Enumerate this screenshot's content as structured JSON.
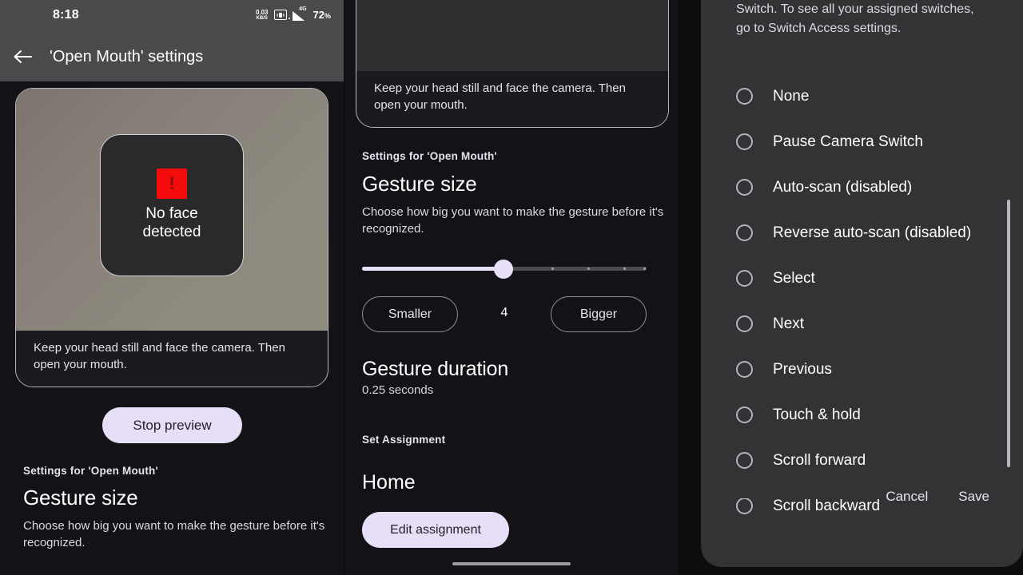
{
  "left_panel": {
    "status_bar": {
      "time": "8:18",
      "data_rate_value": "0.03",
      "data_rate_unit": "KB/S",
      "vibrate_icon": "vibrate-icon",
      "signal_label": "4G",
      "battery": "72",
      "battery_unit": "%"
    },
    "app_bar": {
      "back_icon": "back-arrow-icon",
      "title": "'Open Mouth' settings"
    },
    "preview": {
      "status_icon": "warning-icon",
      "status_glyph": "!",
      "status_text": "No face\ndetected",
      "caption": "Keep your head still and face the camera. Then open your mouth."
    },
    "stop_preview_label": "Stop preview",
    "section": {
      "overline": "Settings for 'Open Mouth'",
      "title": "Gesture size",
      "description": "Choose how big you want to make the gesture before it's recognized."
    }
  },
  "middle_panel": {
    "preview_caption": "Keep your head still and face the camera. Then open your mouth.",
    "section": {
      "overline": "Settings for 'Open Mouth'",
      "title": "Gesture size",
      "description": "Choose how big you want to make the gesture before it's recognized."
    },
    "slider": {
      "value": "4",
      "min": 0,
      "max": 8,
      "fill_percent": 50,
      "smaller_label": "Smaller",
      "bigger_label": "Bigger"
    },
    "gesture_duration": {
      "title": "Gesture duration",
      "value": "0.25 seconds"
    },
    "assignment": {
      "overline": "Set Assignment",
      "value": "Home",
      "edit_label": "Edit assignment"
    }
  },
  "right_panel": {
    "dialog": {
      "description": "Switch. To see all your assigned switches, go to Switch Access settings.",
      "options": [
        {
          "label": "None",
          "selected": false
        },
        {
          "label": "Pause Camera Switch",
          "selected": false
        },
        {
          "label": "Auto-scan (disabled)",
          "selected": false
        },
        {
          "label": "Reverse auto-scan (disabled)",
          "selected": false
        },
        {
          "label": "Select",
          "selected": false
        },
        {
          "label": "Next",
          "selected": false
        },
        {
          "label": "Previous",
          "selected": false
        },
        {
          "label": "Touch & hold",
          "selected": false
        },
        {
          "label": "Scroll forward",
          "selected": false
        },
        {
          "label": "Scroll backward",
          "selected": false
        }
      ],
      "cancel_label": "Cancel",
      "save_label": "Save"
    }
  },
  "colors": {
    "accent": "#e7dff8",
    "warning": "#f40c0c",
    "app_bar": "#4a4a4c",
    "dialog_bg": "#333336",
    "page_bg": "#131317"
  }
}
